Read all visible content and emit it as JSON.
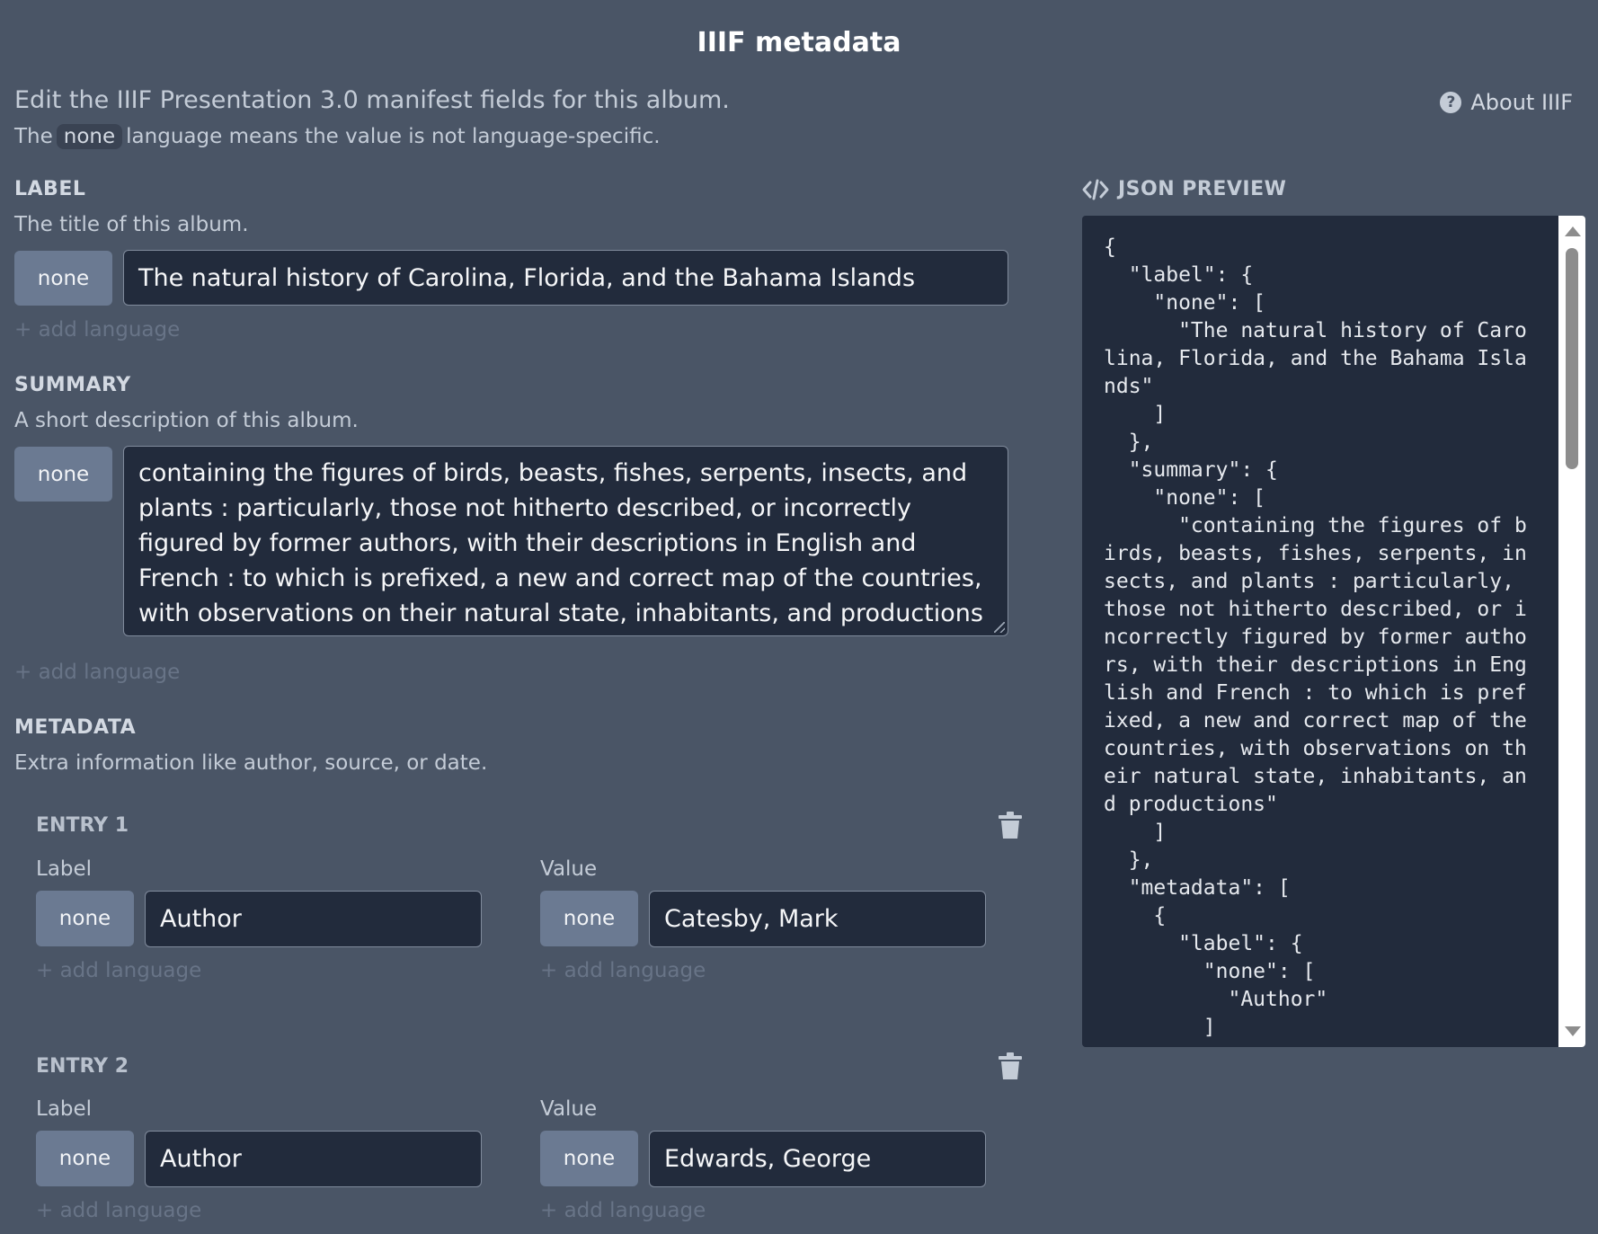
{
  "page": {
    "title": "IIIF metadata",
    "intro_line1": "Edit the IIIF Presentation 3.0 manifest fields for this album.",
    "intro_line2_pre": "The",
    "intro_line2_code": "none",
    "intro_line2_post": "language means the value is not language-specific.",
    "about_label": "About IIIF",
    "help_icon_glyph": "?"
  },
  "label_section": {
    "title": "LABEL",
    "description": "The title of this album.",
    "language": "none",
    "value": "The natural history of Carolina, Florida, and the Bahama Islands",
    "add_language": "+ add language"
  },
  "summary_section": {
    "title": "SUMMARY",
    "description": "A short description of this album.",
    "language": "none",
    "value": "containing the figures of birds, beasts, fishes, serpents, insects, and plants : particularly, those not hitherto described, or incorrectly figured by former authors, with their descriptions in English and French : to which is prefixed, a new and correct map of the countries, with observations on their natural state, inhabitants, and productions",
    "add_language": "+ add language"
  },
  "metadata_section": {
    "title": "METADATA",
    "description": "Extra information like author, source, or date.",
    "entries": [
      {
        "title": "ENTRY 1",
        "label_caption": "Label",
        "value_caption": "Value",
        "label_language": "none",
        "label_value": "Author",
        "value_language": "none",
        "value_value": "Catesby, Mark",
        "add_language": "+ add language"
      },
      {
        "title": "ENTRY 2",
        "label_caption": "Label",
        "value_caption": "Value",
        "label_language": "none",
        "label_value": "Author",
        "value_language": "none",
        "value_value": "Edwards, George",
        "add_language": "+ add language"
      }
    ]
  },
  "json_preview": {
    "title": "JSON PREVIEW",
    "icon": "code-icon",
    "content": "{\n  \"label\": {\n    \"none\": [\n      \"The natural history of Caro\nlina, Florida, and the Bahama Isla\nnds\"\n    ]\n  },\n  \"summary\": {\n    \"none\": [\n      \"containing the figures of b\nirds, beasts, fishes, serpents, in\nsects, and plants : particularly,\nthose not hitherto described, or i\nncorrectly figured by former autho\nrs, with their descriptions in Eng\nlish and French : to which is pref\nixed, a new and correct map of the\ncountries, with observations on th\neir natural state, inhabitants, an\nd productions\"\n    ]\n  },\n  \"metadata\": [\n    {\n      \"label\": {\n        \"none\": [\n          \"Author\"\n        ]"
  }
}
